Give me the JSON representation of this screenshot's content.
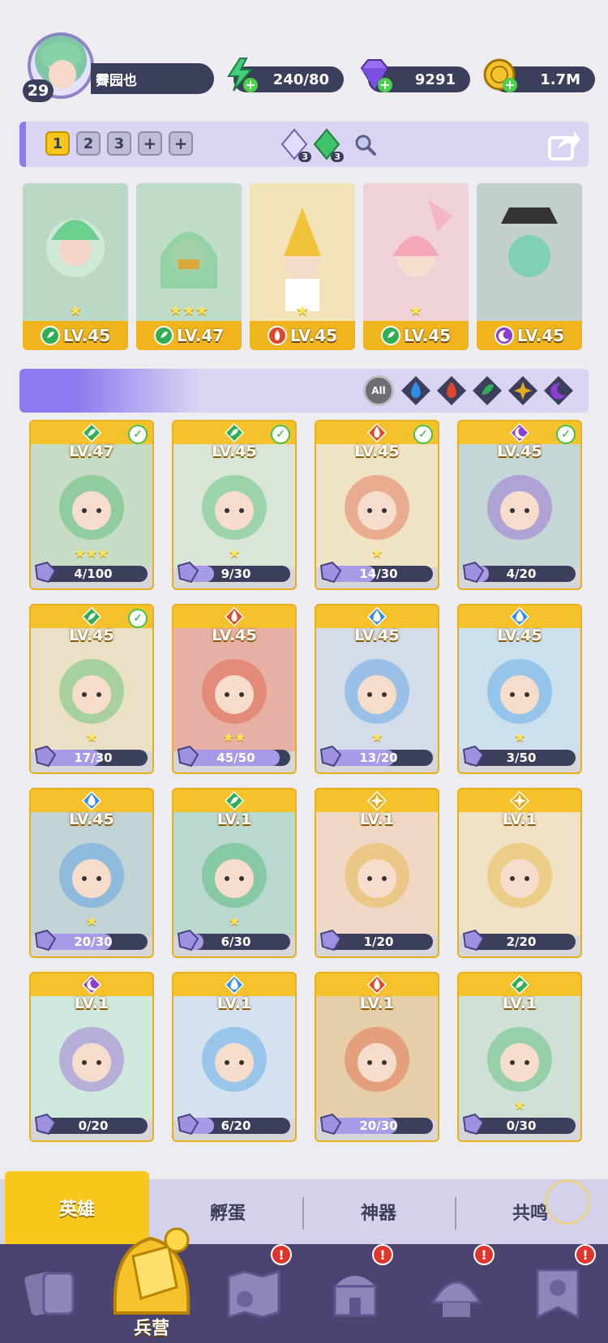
{
  "player": {
    "level": "29",
    "name": "霽园也"
  },
  "resources": [
    {
      "name": "energy",
      "icon": "lightning-icon",
      "value": "240/80"
    },
    {
      "name": "gems",
      "icon": "gem-icon",
      "value": "9291"
    },
    {
      "name": "gold",
      "icon": "coin-icon",
      "value": "1.7M"
    }
  ],
  "team_bar": {
    "tabs": [
      "1",
      "2",
      "3"
    ],
    "active_tab": "1",
    "add_label": "+",
    "crystals": [
      {
        "icon": "light-crystal-icon",
        "count": "3"
      },
      {
        "icon": "nature-crystal-icon",
        "count": "3"
      }
    ]
  },
  "team": [
    {
      "element": "nature",
      "level": "LV.45",
      "stars": "★"
    },
    {
      "element": "nature",
      "level": "LV.47",
      "stars": "★★★"
    },
    {
      "element": "fire",
      "level": "LV.45",
      "stars": "★"
    },
    {
      "element": "nature",
      "level": "LV.45",
      "stars": "★"
    },
    {
      "element": "dark",
      "level": "LV.45",
      "stars": ""
    }
  ],
  "filters": [
    "All",
    "water",
    "fire",
    "nature",
    "light",
    "dark"
  ],
  "heroes": [
    {
      "element": "nature",
      "level": "LV.47",
      "shards": "4/100",
      "progress": 0.04,
      "checked": true,
      "stars": "★★★"
    },
    {
      "element": "nature",
      "level": "LV.45",
      "shards": "9/30",
      "progress": 0.3,
      "checked": true,
      "stars": "★"
    },
    {
      "element": "fire",
      "level": "LV.45",
      "shards": "14/30",
      "progress": 0.47,
      "checked": true,
      "stars": "★"
    },
    {
      "element": "dark",
      "level": "LV.45",
      "shards": "4/20",
      "progress": 0.2,
      "checked": true,
      "stars": ""
    },
    {
      "element": "nature",
      "level": "LV.45",
      "shards": "17/30",
      "progress": 0.57,
      "checked": true,
      "stars": "★"
    },
    {
      "element": "fire",
      "level": "LV.45",
      "shards": "45/50",
      "progress": 0.9,
      "checked": false,
      "stars": "★★"
    },
    {
      "element": "water",
      "level": "LV.45",
      "shards": "13/20",
      "progress": 0.65,
      "checked": false,
      "stars": "★"
    },
    {
      "element": "water",
      "level": "LV.45",
      "shards": "3/50",
      "progress": 0.06,
      "checked": false,
      "stars": "★"
    },
    {
      "element": "water",
      "level": "LV.45",
      "shards": "20/30",
      "progress": 0.67,
      "checked": false,
      "stars": "★"
    },
    {
      "element": "nature",
      "level": "LV.1",
      "shards": "6/30",
      "progress": 0.2,
      "checked": false,
      "stars": "★"
    },
    {
      "element": "light",
      "level": "LV.1",
      "shards": "1/20",
      "progress": 0.05,
      "checked": false,
      "stars": ""
    },
    {
      "element": "light",
      "level": "LV.1",
      "shards": "2/20",
      "progress": 0.1,
      "checked": false,
      "stars": ""
    },
    {
      "element": "dark",
      "level": "LV.1",
      "shards": "0/20",
      "progress": 0,
      "checked": false,
      "stars": ""
    },
    {
      "element": "water",
      "level": "LV.1",
      "shards": "6/20",
      "progress": 0.3,
      "checked": false,
      "stars": ""
    },
    {
      "element": "fire",
      "level": "LV.1",
      "shards": "20/30",
      "progress": 0.67,
      "checked": false,
      "stars": ""
    },
    {
      "element": "nature",
      "level": "LV.1",
      "shards": "0/30",
      "progress": 0,
      "checked": false,
      "stars": "★"
    }
  ],
  "sub_tabs": [
    "英雄",
    "孵蛋",
    "神器",
    "共鸣"
  ],
  "active_sub_tab": "英雄",
  "bottom_nav": {
    "active_label": "兵营",
    "items": [
      {
        "icon": "cards-icon",
        "alert": false
      },
      {
        "icon": "barracks-icon",
        "alert": false
      },
      {
        "icon": "map-icon",
        "alert": true
      },
      {
        "icon": "temple-icon",
        "alert": true
      },
      {
        "icon": "guild-icon",
        "alert": true
      },
      {
        "icon": "banner-icon",
        "alert": true
      }
    ],
    "alert_mark": "!"
  },
  "colors": {
    "water": "#2f8fe6",
    "fire": "#e0462a",
    "nature": "#2fae56",
    "light": "#e6a91b",
    "dark": "#8a3fd0",
    "accent": "#f6c71b",
    "panel": "#3b3f5c"
  }
}
